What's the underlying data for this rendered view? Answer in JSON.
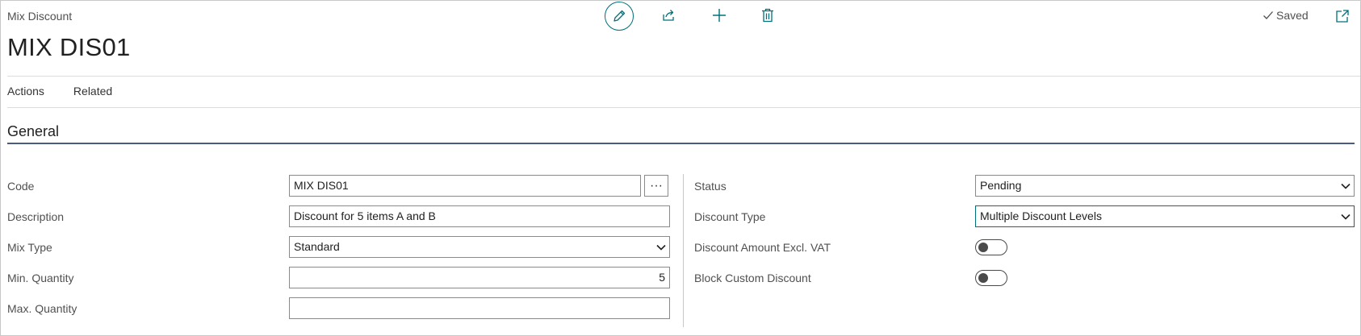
{
  "header": {
    "breadcrumb": "Mix Discount",
    "title": "MIX DIS01",
    "saved_label": "Saved",
    "accent_color": "#00707a"
  },
  "toolbar": {
    "icons": [
      "edit-pencil-icon",
      "share-icon",
      "add-icon",
      "delete-icon",
      "open-in-new-window-icon"
    ]
  },
  "menu": {
    "actions": "Actions",
    "related": "Related"
  },
  "section": {
    "title": "General"
  },
  "left_fields": {
    "code": {
      "label": "Code",
      "value": "MIX DIS01",
      "lookup": "···"
    },
    "description": {
      "label": "Description",
      "value": "Discount for 5 items A and B"
    },
    "mix_type": {
      "label": "Mix Type",
      "value": "Standard"
    },
    "min_quantity": {
      "label": "Min. Quantity",
      "value": "5"
    },
    "max_quantity": {
      "label": "Max. Quantity",
      "value": ""
    }
  },
  "right_fields": {
    "status": {
      "label": "Status",
      "value": "Pending"
    },
    "discount_type": {
      "label": "Discount Type",
      "value": "Multiple Discount Levels"
    },
    "discount_amount_excl_vat": {
      "label": "Discount Amount Excl. VAT",
      "on": false
    },
    "block_custom_discount": {
      "label": "Block Custom Discount",
      "on": false
    }
  }
}
